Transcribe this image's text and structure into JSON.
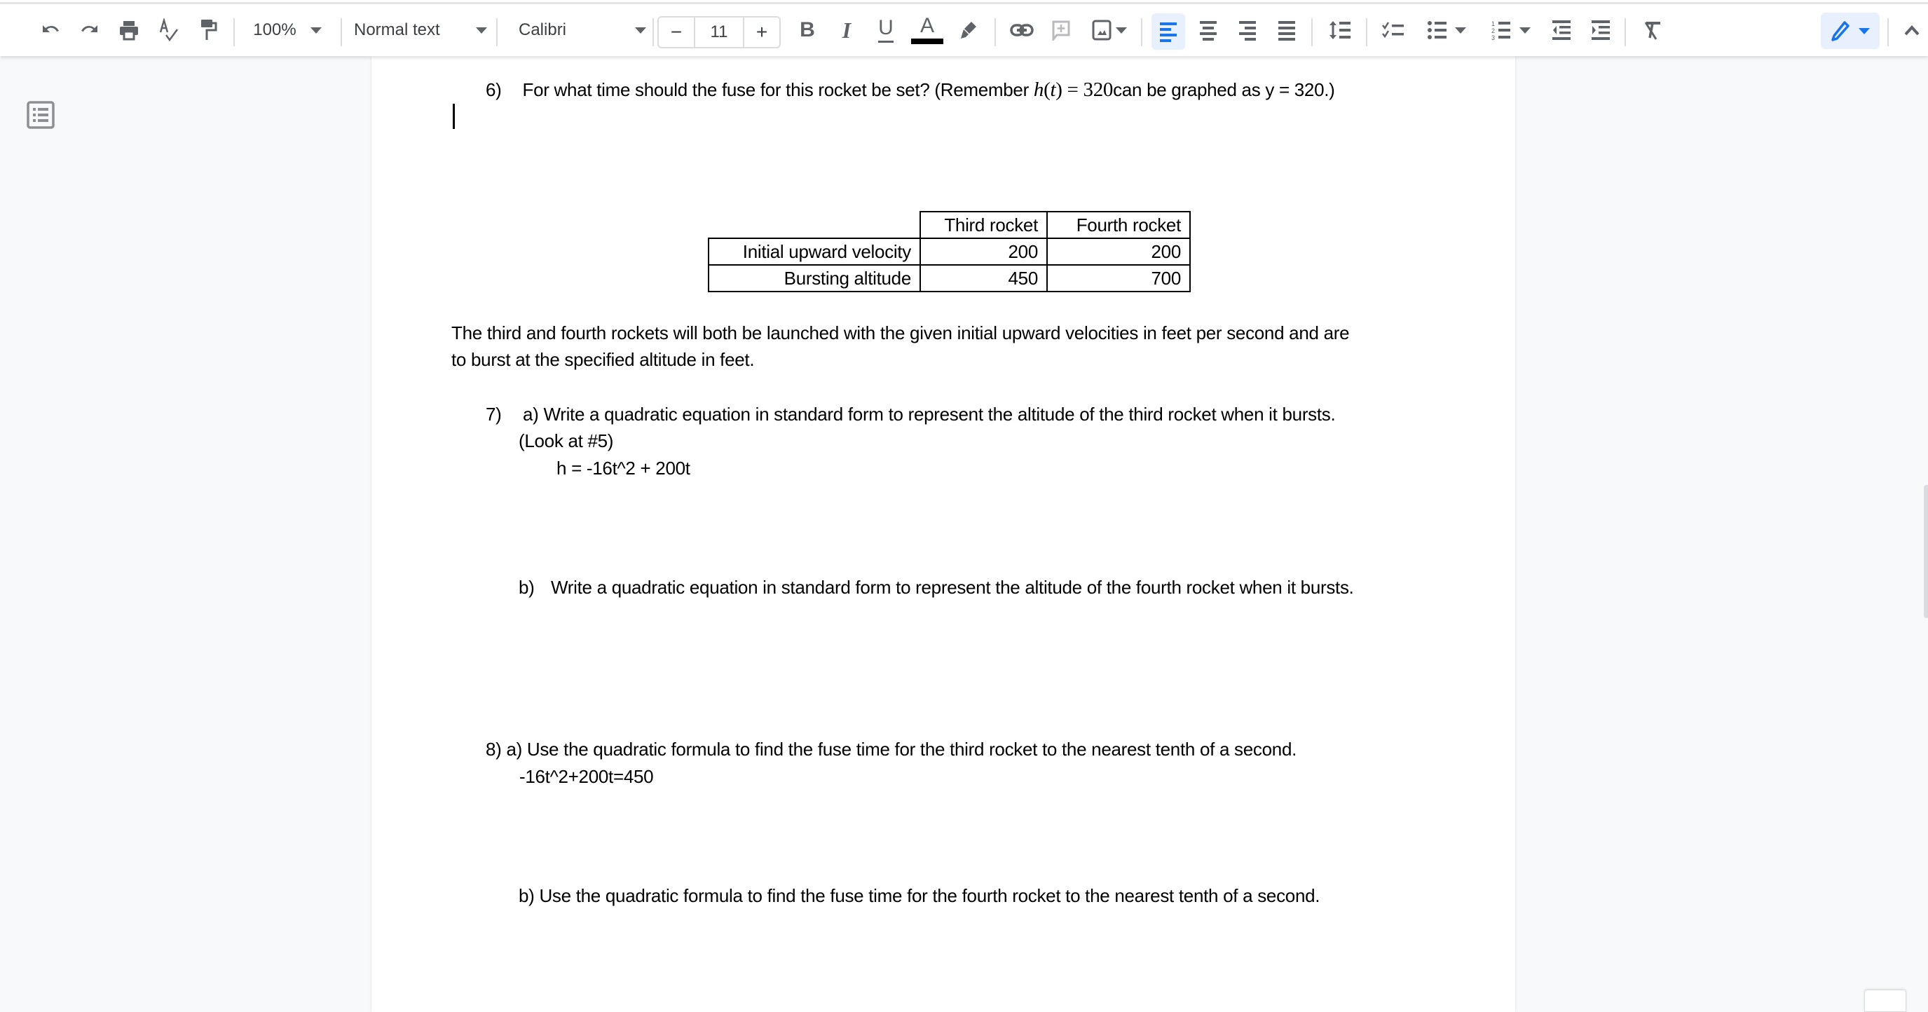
{
  "toolbar": {
    "undo_icon": "undo-icon",
    "redo_icon": "redo-icon",
    "print_icon": "print-icon",
    "spellcheck_icon": "spellcheck-icon",
    "paint_format_icon": "paint-format-icon",
    "zoom": "100%",
    "style": "Normal text",
    "font": "Calibri",
    "font_size": "11",
    "font_size_decrease": "−",
    "font_size_increase": "+",
    "bold": "B",
    "italic": "I",
    "underline": "U",
    "text_color": "A",
    "text_color_value": "#000000",
    "accent_color": "#1a73e8",
    "active_bg_color": "#e8f0fe",
    "alignment_selected": "left",
    "editing_mode_icon": "pencil-icon"
  },
  "document": {
    "q6": {
      "number": "6)",
      "text_before": "For what time should the fuse for this rocket be set?  (Remember ",
      "math_h": "h",
      "math_t": "t",
      "text_eq": "(",
      "text_eq2": ") =  320",
      "text_after": "can be graphed as y = 320.)"
    },
    "table": {
      "headers": [
        "",
        "Third rocket",
        "Fourth rocket"
      ],
      "rows": [
        {
          "label": "Initial upward velocity",
          "third": "200",
          "fourth": "200"
        },
        {
          "label": "Bursting altitude",
          "third": "450",
          "fourth": "700"
        }
      ]
    },
    "paragraph_line1": "The third and fourth rockets will both be launched with the given initial upward velocities in feet per second and are",
    "paragraph_line2": "to burst at the specified altitude in feet.",
    "q7": {
      "number": "7)",
      "a_line1": "a) Write a quadratic equation in standard form to represent the altitude of the third rocket when it bursts.",
      "a_line2": "(Look at #5)",
      "a_answer": "h = -16t^2 + 200t",
      "b_label": "b)",
      "b_text": "Write a quadratic equation in standard form to represent the altitude of the fourth rocket when it bursts."
    },
    "q8": {
      "a_line": "8) a) Use the quadratic formula to find the fuse time for the third rocket to the nearest tenth of a second.",
      "a_answer": "-16t^2+200t=450",
      "b_line": "b) Use the quadratic formula to find the fuse time for the fourth rocket to the nearest tenth of a second."
    }
  }
}
